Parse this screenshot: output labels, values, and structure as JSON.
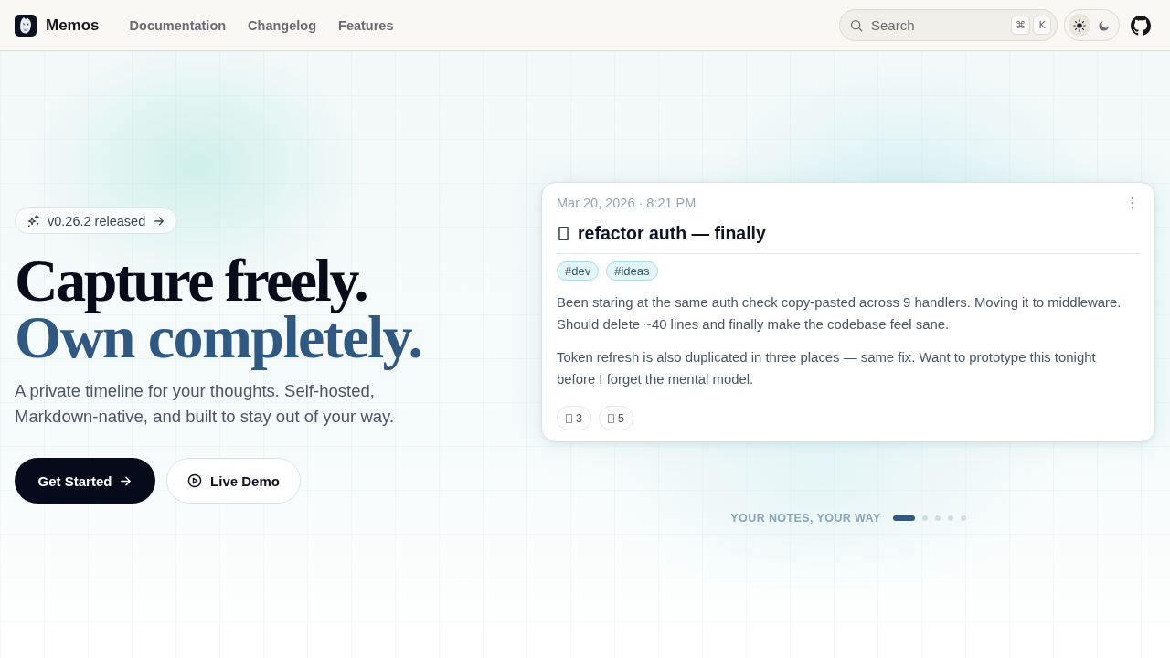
{
  "nav": {
    "brand": "Memos",
    "links": [
      {
        "label": "Documentation"
      },
      {
        "label": "Changelog"
      },
      {
        "label": "Features"
      }
    ],
    "search": {
      "placeholder": "Search",
      "shortcut": [
        "⌘",
        "K"
      ]
    },
    "theme_toggle": [
      {
        "kind": "light",
        "selected": true
      },
      {
        "kind": "dark",
        "selected": false
      }
    ]
  },
  "hero": {
    "release_badge": "v0.26.2 released",
    "headline": [
      {
        "text": "Capture freely.",
        "kind": "plain"
      },
      {
        "text": "Own completely.",
        "kind": "accent"
      }
    ],
    "subtitle": "A private timeline for your thoughts. Self-hosted, Markdown-native, and built to stay out of your way.",
    "buttons": [
      {
        "label": "Get Started",
        "kind": "primary"
      },
      {
        "label": "Live Demo",
        "kind": "secondary"
      }
    ]
  },
  "memo_card": {
    "timestamp": "Mar 20, 2026 · 8:21 PM",
    "title": "refactor auth — finally",
    "tags": [
      "#dev",
      "#ideas"
    ],
    "paragraphs": [
      "Been staring at the same auth check copy-pasted across 9 handlers. Moving it to middleware. Should delete ~40 lines and finally make the codebase feel sane.",
      "Token refresh is also duplicated in three places — same fix. Want to prototype this tonight before I forget the mental model."
    ],
    "reactions": [
      {
        "count": "3"
      },
      {
        "count": "5"
      }
    ]
  },
  "carousel": {
    "label": "YOUR NOTES, YOUR WAY",
    "dots": [
      {
        "selected": true
      },
      {
        "selected": false
      },
      {
        "selected": false
      },
      {
        "selected": false
      },
      {
        "selected": false
      }
    ]
  }
}
